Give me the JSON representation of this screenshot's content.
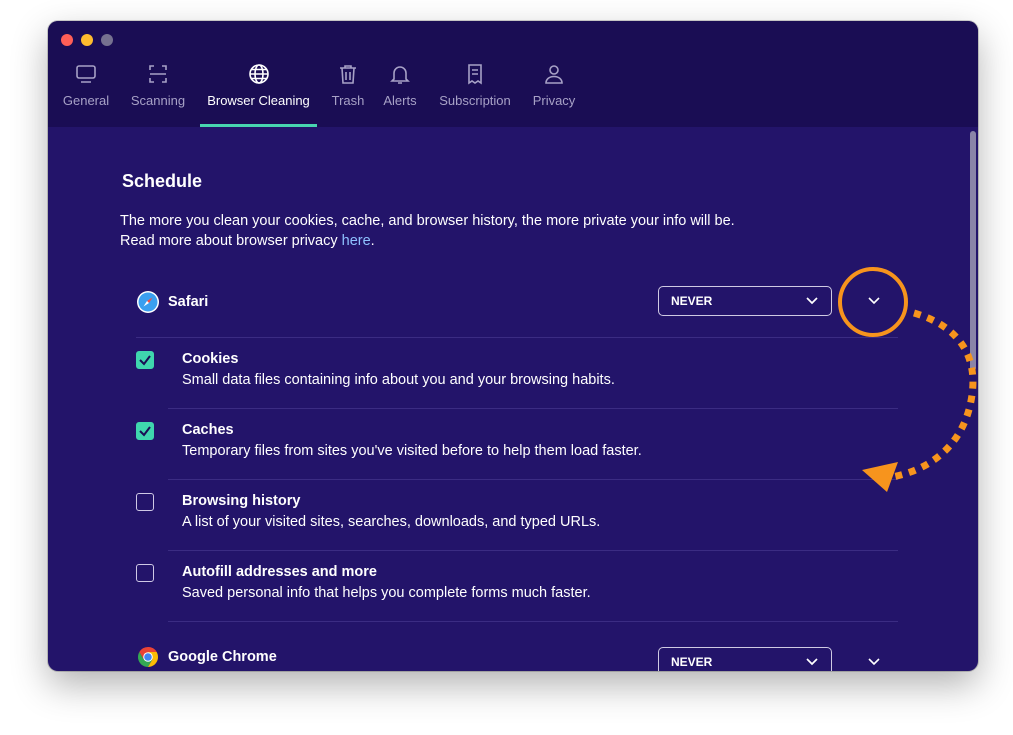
{
  "tabs": [
    {
      "label": "General",
      "icon": "monitor-icon"
    },
    {
      "label": "Scanning",
      "icon": "scan-icon"
    },
    {
      "label": "Browser Cleaning",
      "icon": "globe-icon"
    },
    {
      "label": "Trash",
      "icon": "trash-icon"
    },
    {
      "label": "Alerts",
      "icon": "bell-icon"
    },
    {
      "label": "Subscription",
      "icon": "receipt-icon"
    },
    {
      "label": "Privacy",
      "icon": "person-icon"
    }
  ],
  "active_tab": "Browser Cleaning",
  "section": {
    "title": "Schedule",
    "desc_line1": "The more you clean your cookies, cache, and browser history, the more private your info will be.",
    "desc_line2_prefix": "Read more about browser privacy ",
    "desc_link": "here",
    "desc_line2_suffix": "."
  },
  "browsers": [
    {
      "name": "Safari",
      "schedule": "NEVER",
      "items": [
        {
          "title": "Cookies",
          "desc": "Small data files containing info about you and your browsing habits.",
          "checked": true
        },
        {
          "title": "Caches",
          "desc": "Temporary files from sites you've visited before to help them load faster.",
          "checked": true
        },
        {
          "title": "Browsing history",
          "desc": "A list of your visited sites, searches, downloads, and typed URLs.",
          "checked": false
        },
        {
          "title": "Autofill addresses and more",
          "desc": "Saved personal info that helps you complete forms much faster.",
          "checked": false
        }
      ]
    },
    {
      "name": "Google Chrome",
      "schedule": "NEVER"
    }
  ],
  "colors": {
    "window_bg": "#23146a",
    "titlebar_bg": "#1a0d54",
    "accent_tab": "#48d5b0",
    "checkbox_checked": "#3fd6ae",
    "link": "#8fc2ff",
    "annotation": "#f7941d"
  }
}
